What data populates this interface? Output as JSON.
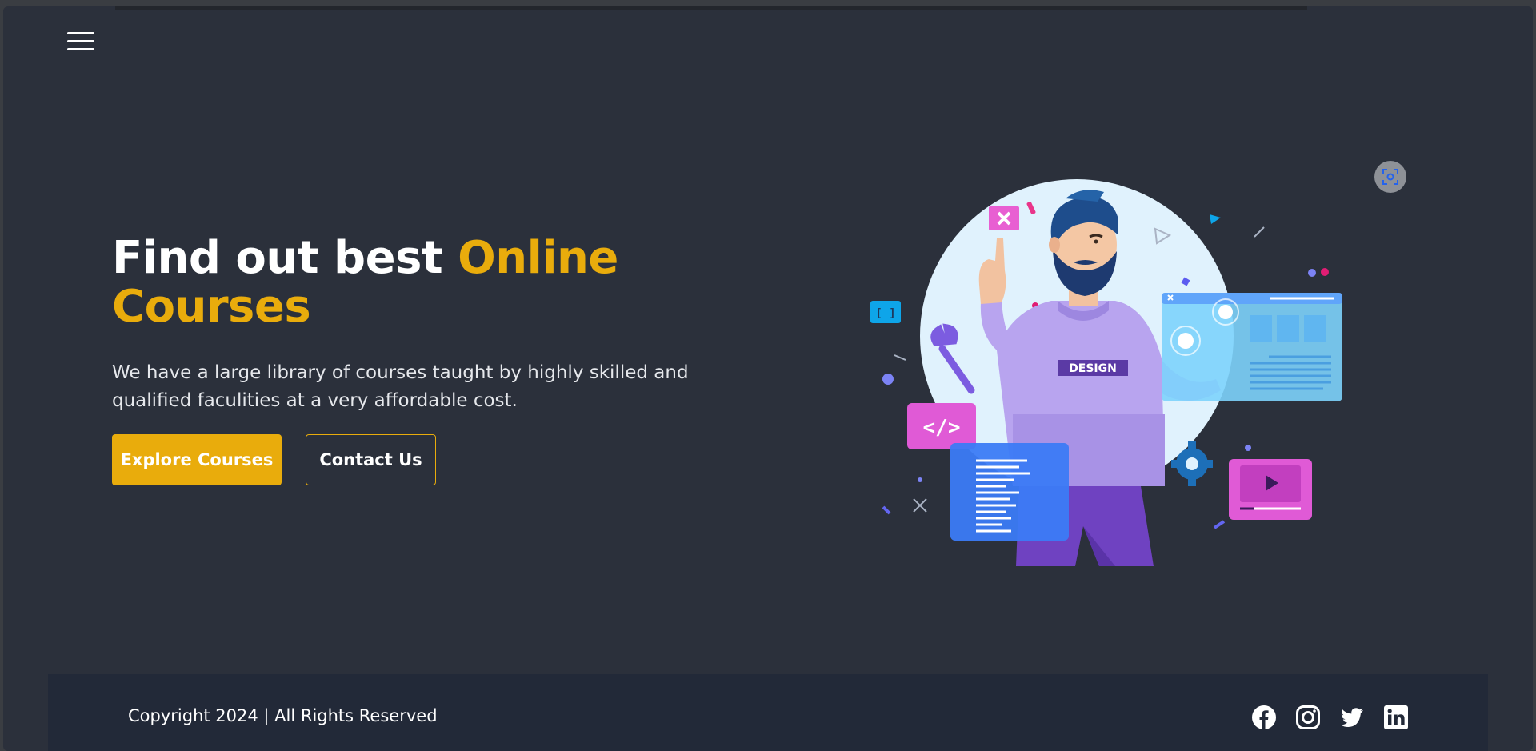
{
  "header": {
    "menu_icon": "hamburger-menu-icon"
  },
  "hero": {
    "title_plain": "Find out best ",
    "title_highlight": "Online Courses",
    "description": "We have a large library of courses taught by highly skilled and qualified faculities at a very affordable cost.",
    "explore_label": "Explore Courses",
    "contact_label": "Contact Us",
    "illustration_badge": "DESIGN",
    "code_tag": "</>",
    "bracket_tag": "[ ]"
  },
  "footer": {
    "copyright": "Copyright 2024 | All Rights Reserved",
    "social": [
      "facebook-icon",
      "instagram-icon",
      "twitter-icon",
      "linkedin-icon"
    ]
  },
  "colors": {
    "accent": "#e9ac0c",
    "background": "#2b303b",
    "footer": "#222938"
  }
}
